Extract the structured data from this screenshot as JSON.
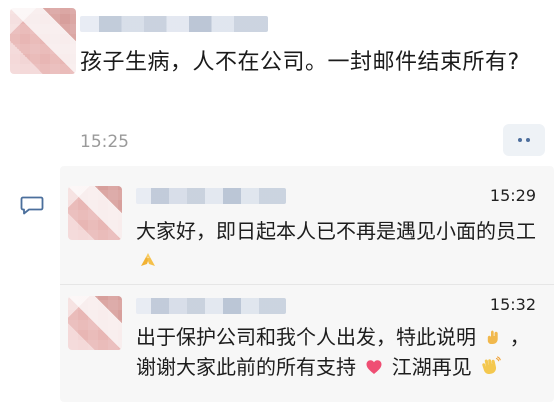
{
  "top_message": {
    "text": "孩子生病，人不在公司。一封邮件结束所有?",
    "time": "15:25",
    "more_button_label": "••"
  },
  "thread": {
    "items": [
      {
        "time": "15:29",
        "text": "大家好，即日起本人已不再是遇见小面的员工",
        "emoji": "pray-icon"
      },
      {
        "time": "15:32",
        "text_line_1": "出于保护公司和我个人出发，特此说明",
        "text_line_2_a": "谢谢大家此前的所有支持",
        "text_line_2_b": "江湖再见",
        "emoji_1": "pointing-hand-icon",
        "emoji_2": "heart-icon",
        "emoji_3": "waving-hand-icon"
      }
    ]
  },
  "colors": {
    "accent_blue": "#4d6e9c",
    "time_gray": "#9a9a9a",
    "panel_bg": "#f7f7f7"
  }
}
